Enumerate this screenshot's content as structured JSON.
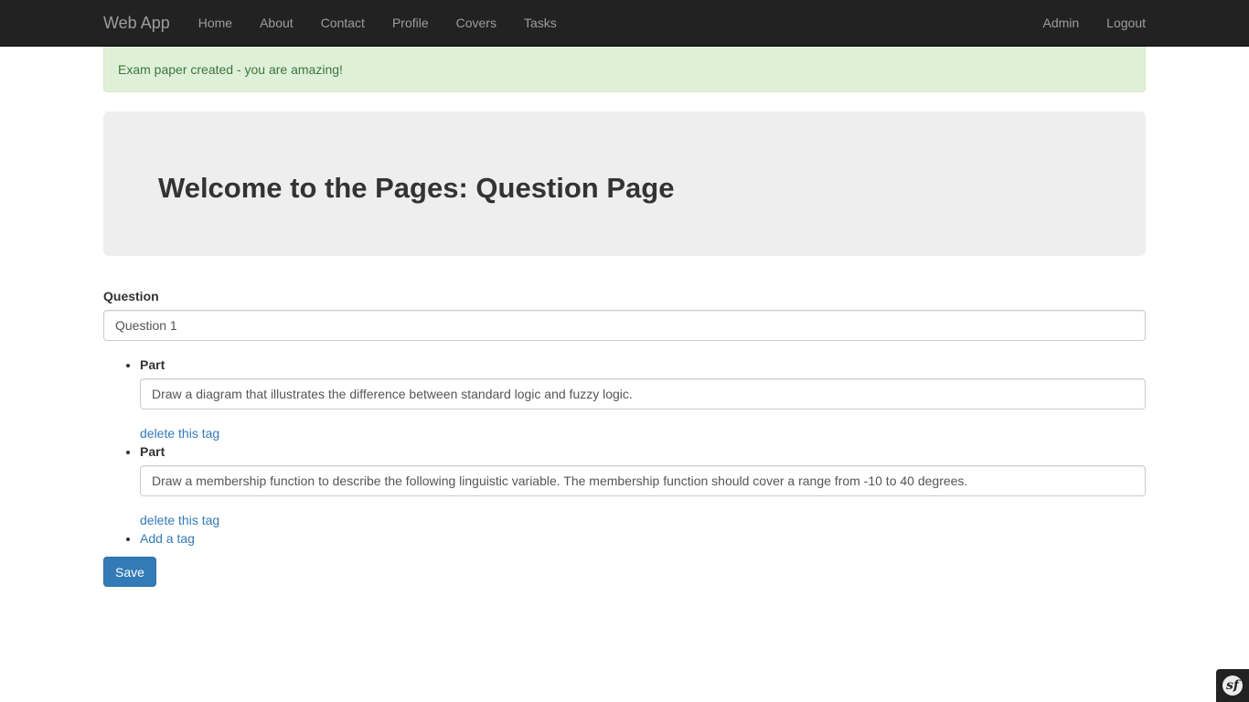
{
  "navbar": {
    "brand": "Web App",
    "links": [
      "Home",
      "About",
      "Contact",
      "Profile",
      "Covers",
      "Tasks"
    ],
    "right_links": [
      "Admin",
      "Logout"
    ]
  },
  "alert": {
    "text": "Exam paper created - you are amazing!"
  },
  "jumbotron": {
    "title": "Welcome to the Pages: Question Page"
  },
  "form": {
    "question_label": "Question",
    "question_value": "Question 1",
    "parts": [
      {
        "label": "Part",
        "value": "Draw a diagram that illustrates the difference between standard logic and fuzzy logic.",
        "delete_label": "delete this tag"
      },
      {
        "label": "Part",
        "value": "Draw a membership function to describe the following linguistic variable. The membership function should cover a range from -10 to 40 degrees.",
        "delete_label": "delete this tag"
      }
    ],
    "add_tag_label": "Add a tag",
    "save_label": "Save"
  },
  "toolbar": {
    "icon": "symfony-icon",
    "glyph": "sf"
  },
  "colors": {
    "navbar_bg": "#222222",
    "alert_bg": "#dff0d8",
    "alert_text": "#3c763d",
    "primary": "#337ab7",
    "jumbotron_bg": "#eeeeee"
  }
}
